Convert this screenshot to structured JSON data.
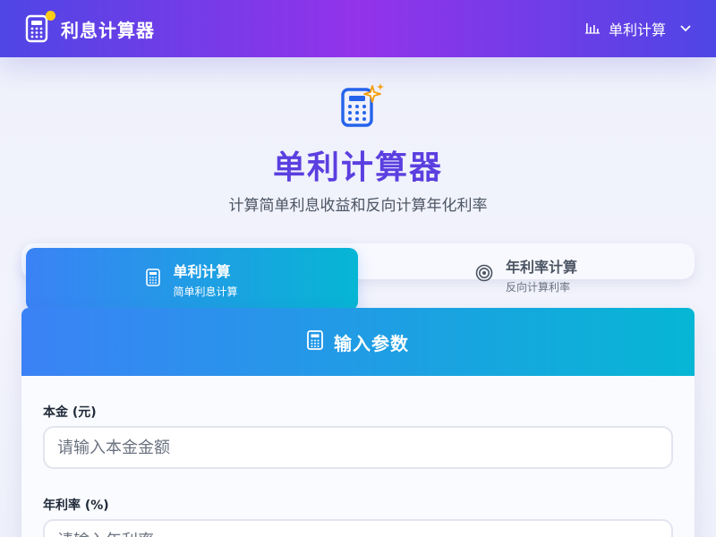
{
  "header": {
    "app_title": "利息计算器",
    "mode_label": "单利计算"
  },
  "hero": {
    "title": "单利计算器",
    "subtitle": "计算简单利息收益和反向计算年化利率"
  },
  "tabs": [
    {
      "title": "单利计算",
      "desc": "简单利息计算",
      "active": true
    },
    {
      "title": "年利率计算",
      "desc": "反向计算利率",
      "active": false
    }
  ],
  "card": {
    "title": "输入参数",
    "fields": [
      {
        "label": "本金 (元)",
        "placeholder": "请输入本金金额",
        "value": ""
      },
      {
        "label": "年利率 (%)",
        "placeholder": "请输入年利率",
        "value": ""
      }
    ]
  },
  "colors": {
    "header_gradient": [
      "#4f46e5",
      "#9333ea"
    ],
    "accent_gradient": [
      "#3b82f6",
      "#06b6d4"
    ],
    "title_color": "#5b3fe0",
    "dot": "#facc15"
  }
}
